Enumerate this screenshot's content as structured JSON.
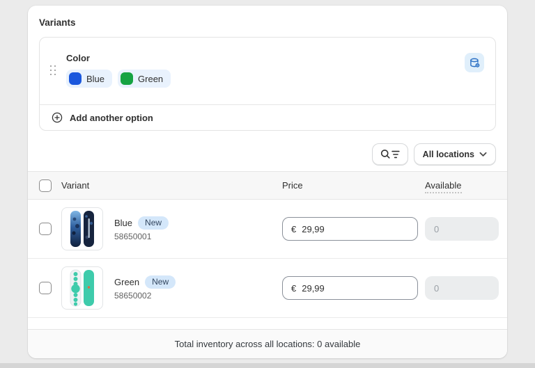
{
  "card": {
    "title": "Variants"
  },
  "option": {
    "name": "Color",
    "values": [
      {
        "label": "Blue",
        "color": "#1a57dd"
      },
      {
        "label": "Green",
        "color": "#16a342"
      }
    ],
    "add_label": "Add another option"
  },
  "toolbar": {
    "locations_label": "All locations"
  },
  "table": {
    "headers": {
      "variant": "Variant",
      "price": "Price",
      "available": "Available"
    },
    "rows": [
      {
        "name": "Blue",
        "badge": "New",
        "sku": "58650001",
        "currency": "€",
        "price": "29,99",
        "available": "0"
      },
      {
        "name": "Green",
        "badge": "New",
        "sku": "58650002",
        "currency": "€",
        "price": "29,99",
        "available": "0"
      }
    ],
    "footer": "Total inventory across all locations: 0 available"
  },
  "icons": {
    "drag_handle": "six-dots",
    "connected_data": "database",
    "add_option": "plus-circle",
    "search_filter": "magnifier-with-filter-lines",
    "location_chevron": "chevron-down"
  },
  "colors": {
    "page_background": "#ebebeb",
    "card_background": "#ffffff",
    "chip_background": "#e9f2fd",
    "badge_background": "#d4e7fa",
    "db_icon_blue": "#2a6fc4",
    "disabled_input": "#ebedee",
    "teal_board": "#3ecbab",
    "blue_board": "#16243e"
  }
}
